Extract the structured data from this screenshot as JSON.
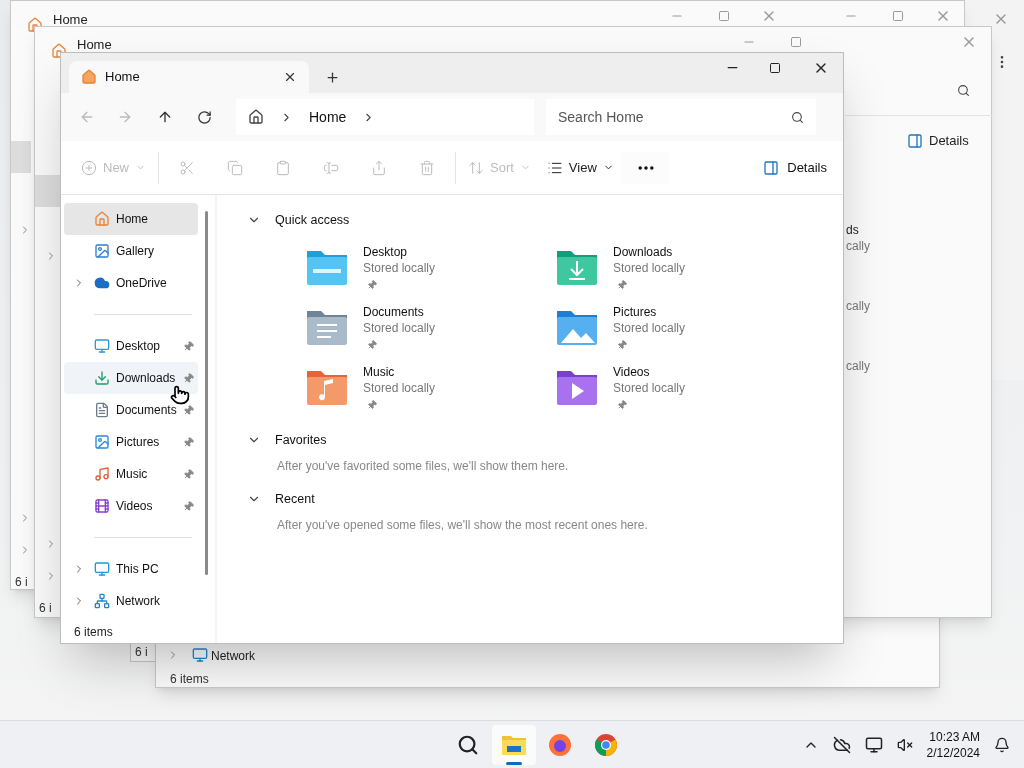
{
  "background_windows": [
    {
      "tab_title": "Home",
      "status": "6 i"
    },
    {
      "tab_title": "Home",
      "status": "6 i",
      "details_label": "Details",
      "item_fragments": [
        {
          "name": "ds",
          "sub": "cally"
        },
        {
          "sub": "cally"
        },
        {
          "sub": "cally"
        }
      ]
    },
    {
      "status": "6 i"
    },
    {
      "nav_item": "Network",
      "status": "6 items"
    }
  ],
  "window": {
    "tab_title": "Home",
    "breadcrumb": [
      "Home"
    ],
    "search": {
      "placeholder": "Search Home"
    }
  },
  "toolbar": [
    {
      "kind": "new",
      "label": "New",
      "disabled": true
    },
    {
      "kind": "cut",
      "disabled": true
    },
    {
      "kind": "copy",
      "disabled": true
    },
    {
      "kind": "paste",
      "disabled": true
    },
    {
      "kind": "rename",
      "disabled": true
    },
    {
      "kind": "share",
      "disabled": true
    },
    {
      "kind": "delete",
      "disabled": true
    },
    {
      "kind": "sort",
      "label": "Sort",
      "disabled": true
    },
    {
      "kind": "view",
      "label": "View",
      "disabled": false
    },
    {
      "kind": "more",
      "disabled": false
    }
  ],
  "details_button": "Details",
  "sidebar": {
    "groups": [
      [
        {
          "kind": "home",
          "label": "Home",
          "selected": true,
          "hovered": false,
          "pinned": false,
          "expandable": false
        },
        {
          "kind": "gallery",
          "label": "Gallery",
          "selected": false,
          "hovered": false,
          "pinned": false,
          "expandable": false
        },
        {
          "kind": "onedrive",
          "label": "OneDrive",
          "selected": false,
          "hovered": false,
          "pinned": false,
          "expandable": true
        }
      ],
      [
        {
          "kind": "desktop",
          "label": "Desktop",
          "selected": false,
          "hovered": false,
          "pinned": true,
          "expandable": false
        },
        {
          "kind": "downloads",
          "label": "Downloads",
          "selected": false,
          "hovered": true,
          "pinned": true,
          "expandable": false
        },
        {
          "kind": "documents",
          "label": "Documents",
          "selected": false,
          "hovered": false,
          "pinned": true,
          "expandable": false
        },
        {
          "kind": "pictures",
          "label": "Pictures",
          "selected": false,
          "hovered": false,
          "pinned": true,
          "expandable": false
        },
        {
          "kind": "music",
          "label": "Music",
          "selected": false,
          "hovered": false,
          "pinned": true,
          "expandable": false
        },
        {
          "kind": "videos",
          "label": "Videos",
          "selected": false,
          "hovered": false,
          "pinned": true,
          "expandable": false
        }
      ],
      [
        {
          "kind": "thispc",
          "label": "This PC",
          "selected": false,
          "hovered": false,
          "pinned": false,
          "expandable": true
        },
        {
          "kind": "network",
          "label": "Network",
          "selected": false,
          "hovered": false,
          "pinned": false,
          "expandable": true
        }
      ]
    ]
  },
  "sections": [
    {
      "title": "Quick access",
      "expanded": true,
      "items": [
        {
          "kind": "desktop",
          "name": "Desktop",
          "sub": "Stored locally",
          "pinned": true
        },
        {
          "kind": "downloads",
          "name": "Downloads",
          "sub": "Stored locally",
          "pinned": true
        },
        {
          "kind": "documents",
          "name": "Documents",
          "sub": "Stored locally",
          "pinned": true
        },
        {
          "kind": "pictures",
          "name": "Pictures",
          "sub": "Stored locally",
          "pinned": true
        },
        {
          "kind": "music",
          "name": "Music",
          "sub": "Stored locally",
          "pinned": true
        },
        {
          "kind": "videos",
          "name": "Videos",
          "sub": "Stored locally",
          "pinned": true
        }
      ]
    },
    {
      "title": "Favorites",
      "expanded": true,
      "message": "After you've favorited some files, we'll show them here."
    },
    {
      "title": "Recent",
      "expanded": true,
      "message": "After you've opened some files, we'll show the most recent ones here."
    }
  ],
  "status_bar": "6 items",
  "taskbar": {
    "apps": [
      {
        "kind": "search",
        "selected": false
      },
      {
        "kind": "explorer",
        "selected": true
      },
      {
        "kind": "firefox",
        "selected": false
      },
      {
        "kind": "chrome",
        "selected": false
      }
    ],
    "time": "10:23 AM",
    "date": "2/12/2024"
  }
}
